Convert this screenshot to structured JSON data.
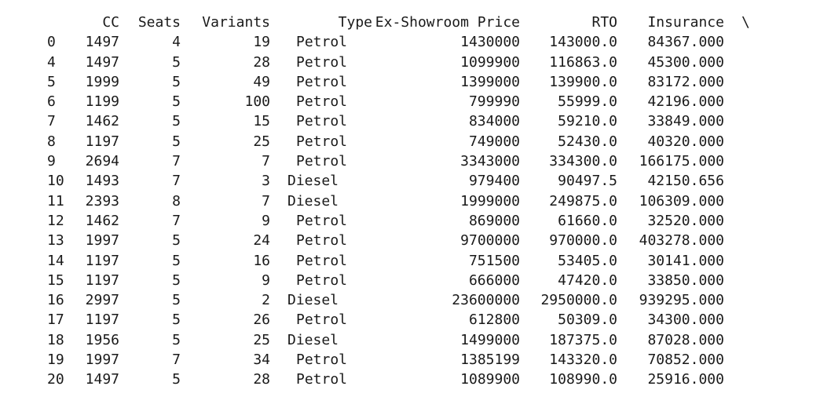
{
  "headers": {
    "cc": "CC",
    "seats": "Seats",
    "variants": "Variants",
    "type": "Type",
    "price": "Ex-Showroom Price",
    "rto": "RTO",
    "insurance": "Insurance",
    "continuation": "\\"
  },
  "rows": [
    {
      "idx": "0",
      "cc": "1497",
      "seats": "4",
      "variants": "19",
      "type": "Petrol",
      "price": "1430000",
      "rto": "143000.0",
      "insurance": "84367.000"
    },
    {
      "idx": "4",
      "cc": "1497",
      "seats": "5",
      "variants": "28",
      "type": "Petrol",
      "price": "1099900",
      "rto": "116863.0",
      "insurance": "45300.000"
    },
    {
      "idx": "5",
      "cc": "1999",
      "seats": "5",
      "variants": "49",
      "type": "Petrol",
      "price": "1399000",
      "rto": "139900.0",
      "insurance": "83172.000"
    },
    {
      "idx": "6",
      "cc": "1199",
      "seats": "5",
      "variants": "100",
      "type": "Petrol",
      "price": "799990",
      "rto": "55999.0",
      "insurance": "42196.000"
    },
    {
      "idx": "7",
      "cc": "1462",
      "seats": "5",
      "variants": "15",
      "type": "Petrol",
      "price": "834000",
      "rto": "59210.0",
      "insurance": "33849.000"
    },
    {
      "idx": "8",
      "cc": "1197",
      "seats": "5",
      "variants": "25",
      "type": "Petrol",
      "price": "749000",
      "rto": "52430.0",
      "insurance": "40320.000"
    },
    {
      "idx": "9",
      "cc": "2694",
      "seats": "7",
      "variants": "7",
      "type": "Petrol",
      "price": "3343000",
      "rto": "334300.0",
      "insurance": "166175.000"
    },
    {
      "idx": "10",
      "cc": "1493",
      "seats": "7",
      "variants": "3",
      "type": "Diesel",
      "price": "979400",
      "rto": "90497.5",
      "insurance": "42150.656"
    },
    {
      "idx": "11",
      "cc": "2393",
      "seats": "8",
      "variants": "7",
      "type": "Diesel",
      "price": "1999000",
      "rto": "249875.0",
      "insurance": "106309.000"
    },
    {
      "idx": "12",
      "cc": "1462",
      "seats": "7",
      "variants": "9",
      "type": "Petrol",
      "price": "869000",
      "rto": "61660.0",
      "insurance": "32520.000"
    },
    {
      "idx": "13",
      "cc": "1997",
      "seats": "5",
      "variants": "24",
      "type": "Petrol",
      "price": "9700000",
      "rto": "970000.0",
      "insurance": "403278.000"
    },
    {
      "idx": "14",
      "cc": "1197",
      "seats": "5",
      "variants": "16",
      "type": "Petrol",
      "price": "751500",
      "rto": "53405.0",
      "insurance": "30141.000"
    },
    {
      "idx": "15",
      "cc": "1197",
      "seats": "5",
      "variants": "9",
      "type": "Petrol",
      "price": "666000",
      "rto": "47420.0",
      "insurance": "33850.000"
    },
    {
      "idx": "16",
      "cc": "2997",
      "seats": "5",
      "variants": "2",
      "type": "Diesel",
      "price": "23600000",
      "rto": "2950000.0",
      "insurance": "939295.000"
    },
    {
      "idx": "17",
      "cc": "1197",
      "seats": "5",
      "variants": "26",
      "type": "Petrol",
      "price": "612800",
      "rto": "50309.0",
      "insurance": "34300.000"
    },
    {
      "idx": "18",
      "cc": "1956",
      "seats": "5",
      "variants": "25",
      "type": "Diesel",
      "price": "1499000",
      "rto": "187375.0",
      "insurance": "87028.000"
    },
    {
      "idx": "19",
      "cc": "1997",
      "seats": "7",
      "variants": "34",
      "type": "Petrol",
      "price": "1385199",
      "rto": "143320.0",
      "insurance": "70852.000"
    },
    {
      "idx": "20",
      "cc": "1497",
      "seats": "5",
      "variants": "28",
      "type": "Petrol",
      "price": "1089900",
      "rto": "108990.0",
      "insurance": "25916.000"
    }
  ]
}
